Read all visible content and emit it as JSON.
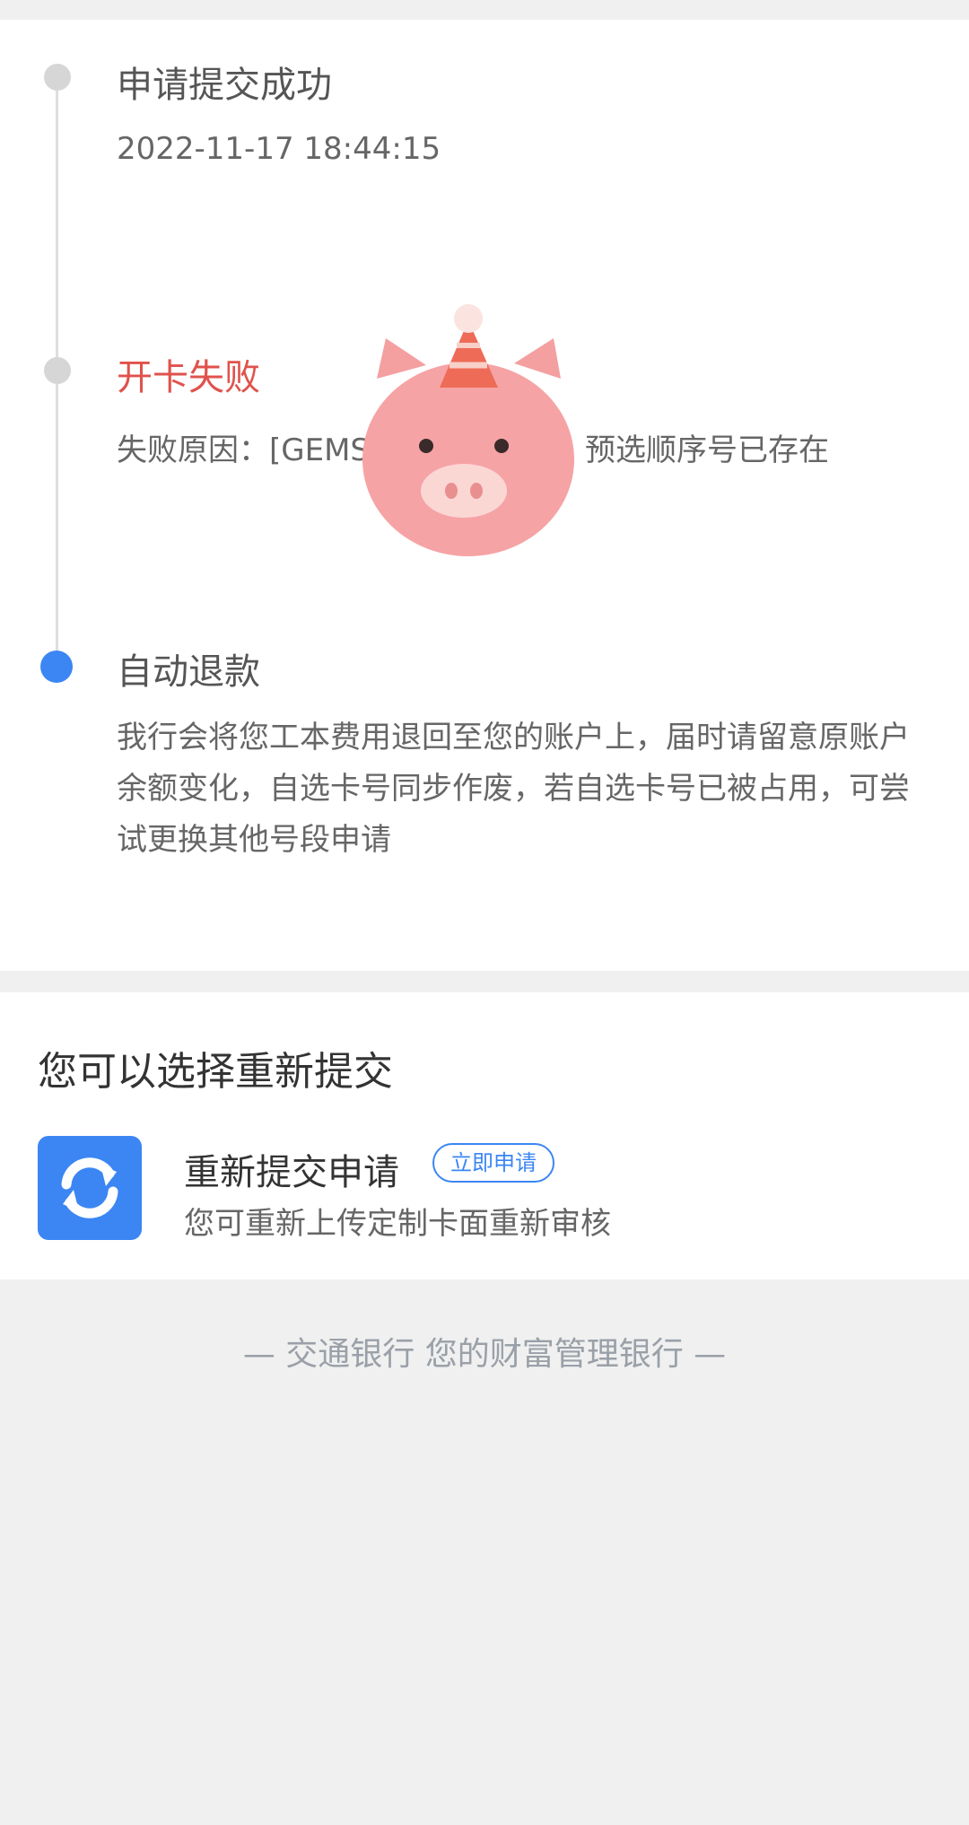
{
  "timeline": {
    "steps": [
      {
        "title": "申请提交成功",
        "subtitle": "2022-11-17 18:44:15",
        "status": "done"
      },
      {
        "title": "开卡失败",
        "subtitle": "失败原因：[GEMS",
        "subtitle_tail": "预选顺序号已存在",
        "status": "failed"
      },
      {
        "title": "自动退款",
        "description": "我行会将您工本费用退回至您的账户上，届时请留意原账户余额变化，自选卡号同步作废，若自选卡号已被占用，可尝试更换其他号段申请",
        "status": "active"
      }
    ]
  },
  "resubmit": {
    "heading": "您可以选择重新提交",
    "action": {
      "icon": "refresh-icon",
      "title": "重新提交申请",
      "badge": "立即申请",
      "description": "您可重新上传定制卡面重新审核"
    }
  },
  "footer": {
    "slogan": "— 交通银行 您的财富管理银行 —"
  },
  "colors": {
    "accent": "#3b86f3",
    "fail": "#e0524c",
    "background": "#f0f0f0"
  },
  "overlay": {
    "icon": "pig-sticker-icon"
  }
}
